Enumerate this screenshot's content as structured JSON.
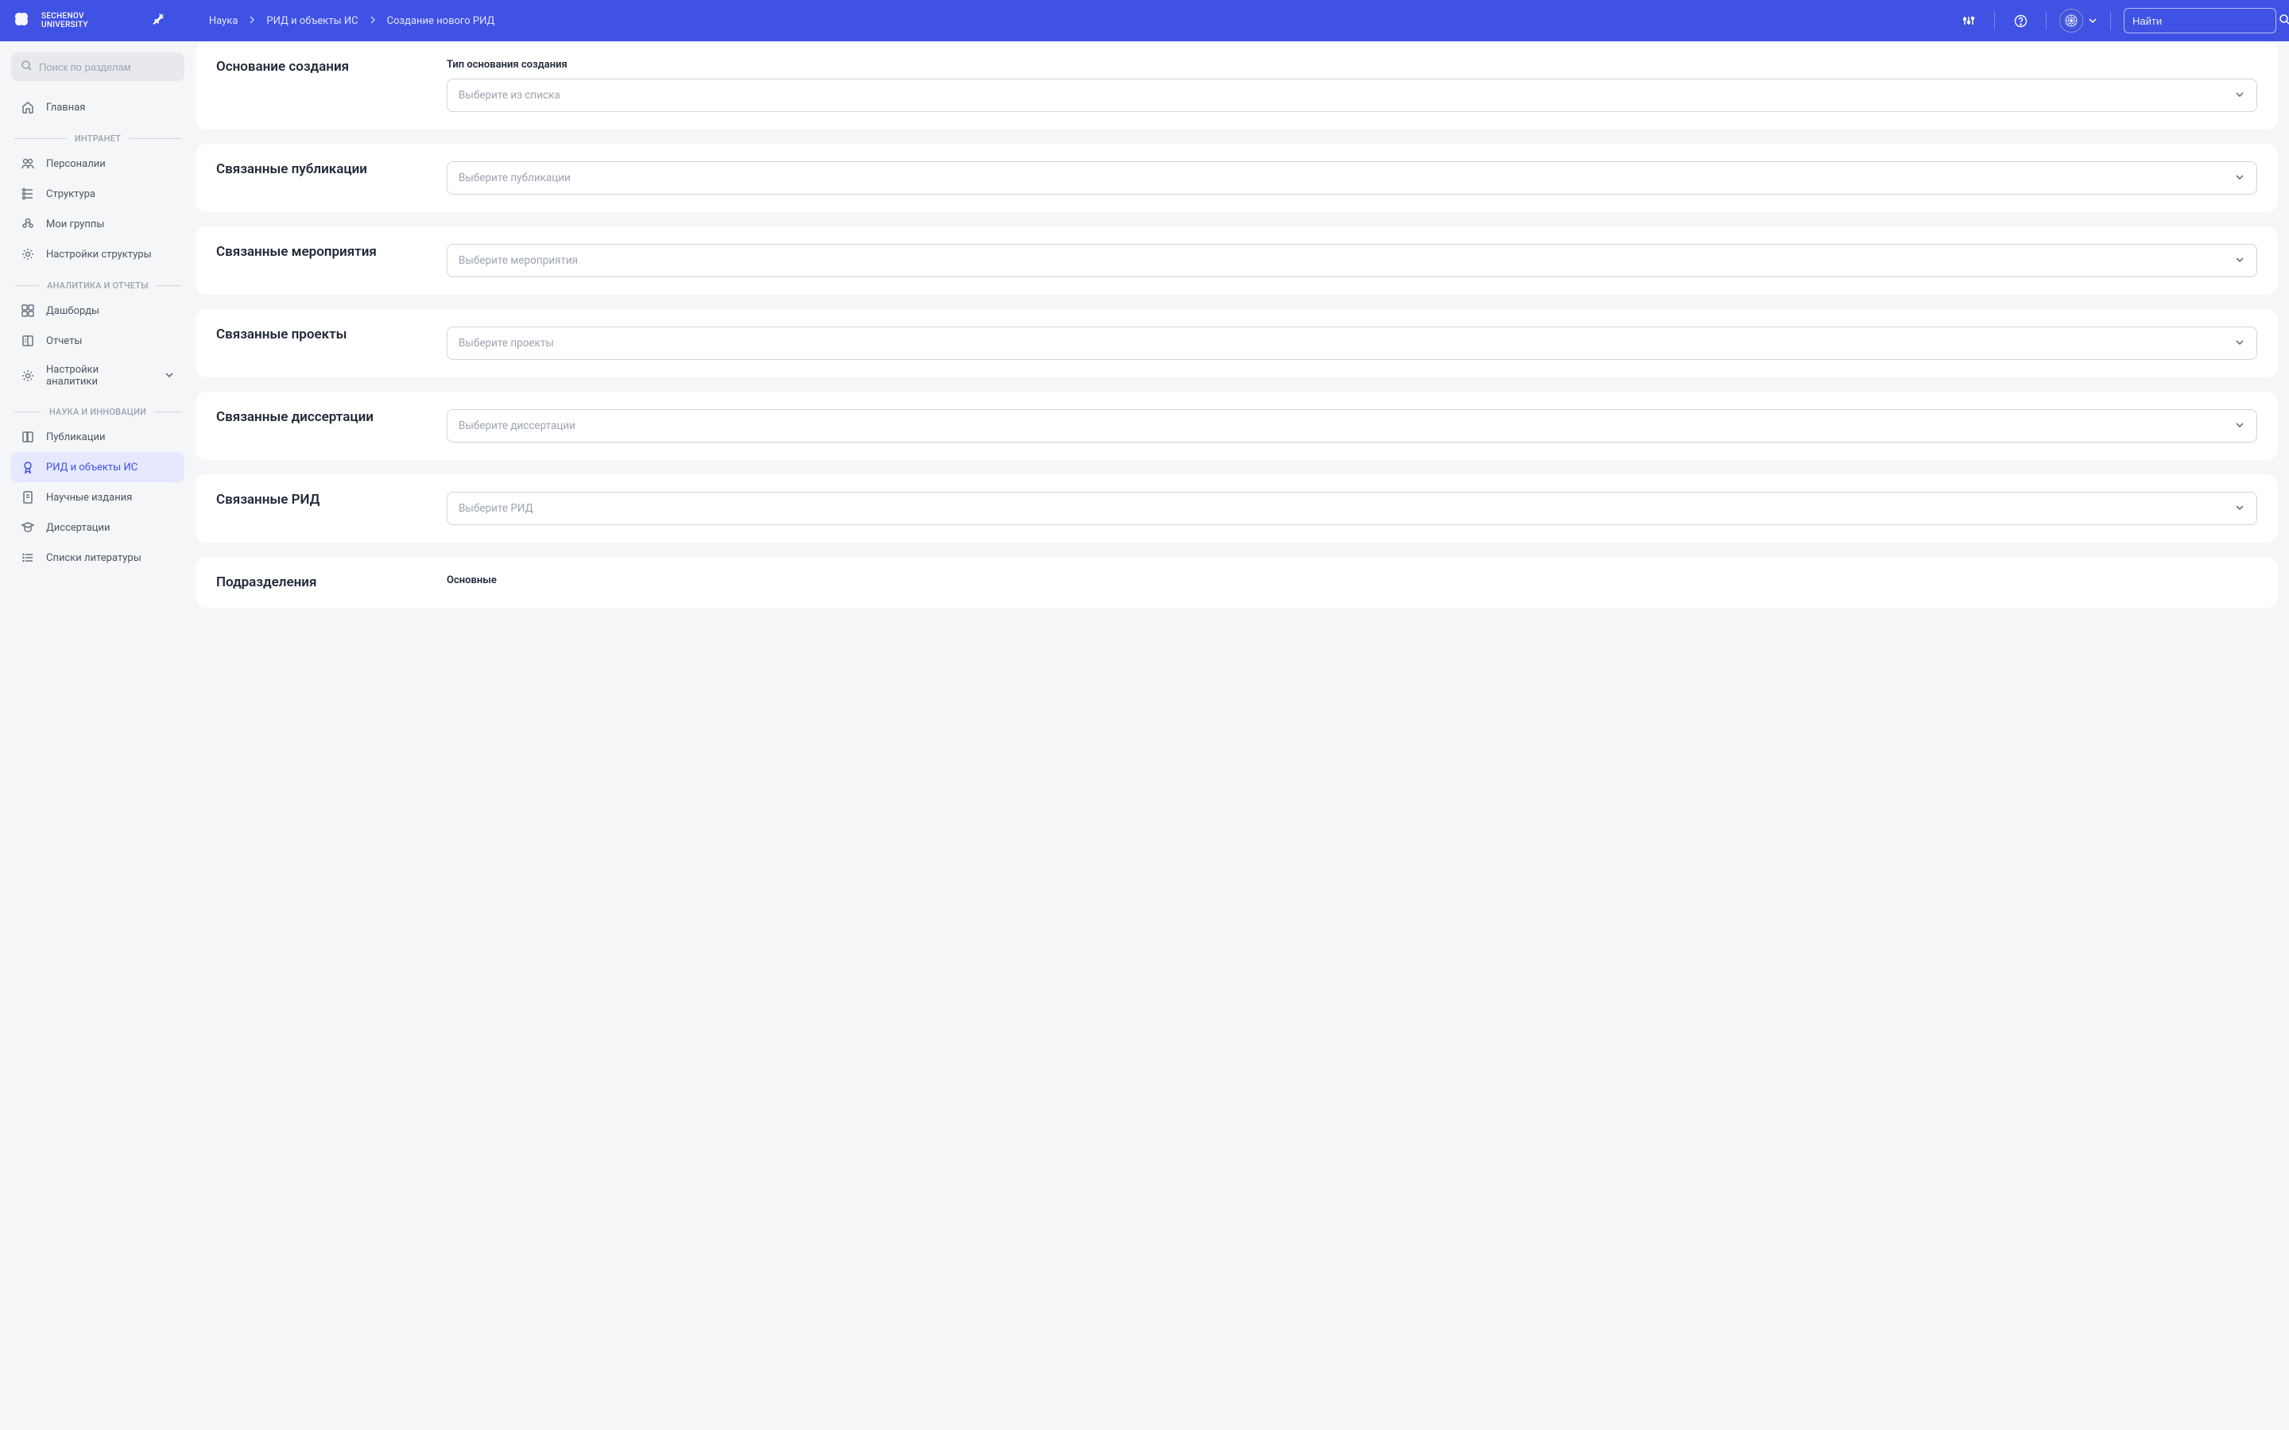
{
  "header": {
    "logo_text_line1": "SECHENOV",
    "logo_text_line2": "UNIVERSITY",
    "breadcrumb": [
      "Наука",
      "РИД и объекты ИС",
      "Создание нового РИД"
    ],
    "search_placeholder": "Найти"
  },
  "sidebar": {
    "search_placeholder": "Поиск по разделам",
    "items": [
      {
        "type": "item",
        "icon": "home",
        "label": "Главная"
      },
      {
        "type": "section",
        "label": "ИНТРАНЕТ"
      },
      {
        "type": "item",
        "icon": "users",
        "label": "Персоналии"
      },
      {
        "type": "item",
        "icon": "structure",
        "label": "Структура"
      },
      {
        "type": "item",
        "icon": "groups",
        "label": "Мои группы"
      },
      {
        "type": "item",
        "icon": "settings",
        "label": "Настройки структуры"
      },
      {
        "type": "section",
        "label": "АНАЛИТИКА И ОТЧЕТЫ"
      },
      {
        "type": "item",
        "icon": "dashboard",
        "label": "Дашборды"
      },
      {
        "type": "item",
        "icon": "reports",
        "label": "Отчеты"
      },
      {
        "type": "item",
        "icon": "settings",
        "label": "Настройки аналитики",
        "chevron": true
      },
      {
        "type": "section",
        "label": "НАУКА И ИННОВАЦИИ"
      },
      {
        "type": "item",
        "icon": "book",
        "label": "Публикации"
      },
      {
        "type": "item",
        "icon": "award",
        "label": "РИД и объекты ИС",
        "active": true
      },
      {
        "type": "item",
        "icon": "journal",
        "label": "Научные издания"
      },
      {
        "type": "item",
        "icon": "grad",
        "label": "Диссертации"
      },
      {
        "type": "item",
        "icon": "list",
        "label": "Списки литературы"
      }
    ]
  },
  "cards": [
    {
      "title": "Основание создания",
      "label": "Тип основания создания",
      "placeholder": "Выберите из списка"
    },
    {
      "title": "Связанные публикации",
      "placeholder": "Выберите публикации"
    },
    {
      "title": "Связанные мероприятия",
      "placeholder": "Выберите мероприятия"
    },
    {
      "title": "Связанные проекты",
      "placeholder": "Выберите проекты"
    },
    {
      "title": "Связанные диссертации",
      "placeholder": "Выберите диссертации"
    },
    {
      "title": "Связанные РИД",
      "placeholder": "Выберите РИД"
    },
    {
      "title": "Подразделения",
      "label": "Основные"
    }
  ]
}
